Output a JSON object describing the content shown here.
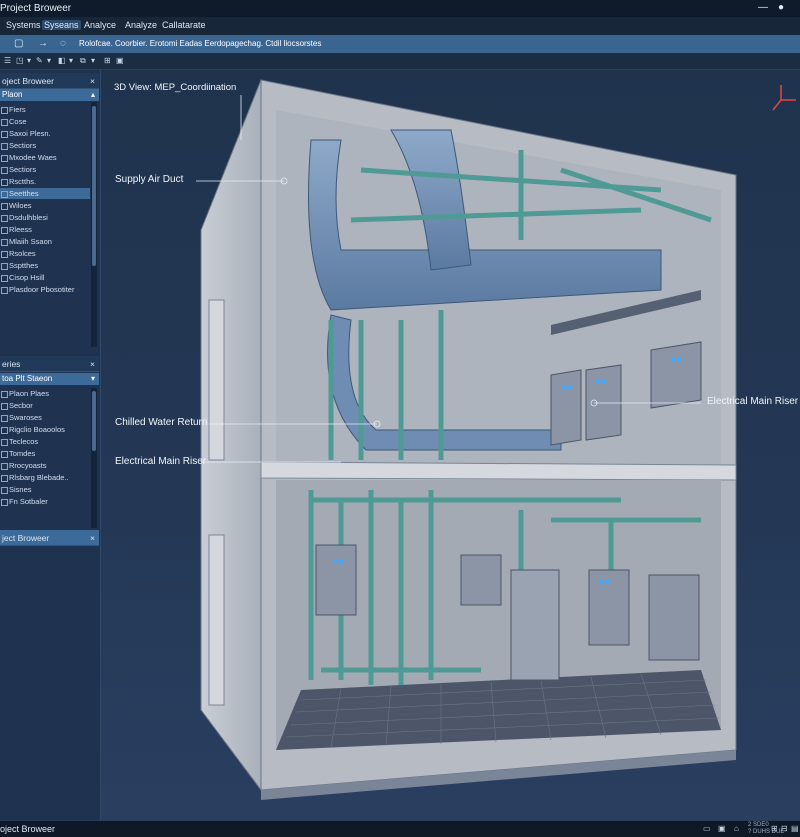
{
  "app": {
    "title": "Project Broweer",
    "window_controls": {
      "minimize": "—",
      "close": "●"
    }
  },
  "menu": {
    "items": [
      "Systems",
      "Syseans",
      "Analyce",
      "Analyze",
      "Callatarate"
    ],
    "active_index": 1
  },
  "ribbon": {
    "icons": [
      "square-icon",
      "arrow-icon",
      "refresh-icon"
    ],
    "text": "Rolofcae. Coorbier. Erotomi Eadas Eerdopagechag. Ctdil liocsorstes"
  },
  "toolbar2": {
    "icons": [
      "☰",
      "◳",
      "▾",
      "✎",
      "▾",
      "◧",
      "▾",
      "⧉",
      "▾",
      "⊞",
      "▣"
    ]
  },
  "sidebar": {
    "panel1": {
      "title": "oject Broweer",
      "close": "×",
      "subheader": "Plaon",
      "items": [
        "Fiers",
        "Cose",
        "Saxoi Plesn.",
        "Sectiors",
        "Mxodee Waes",
        "Sectiors",
        "Rsctths.",
        "Seetthes",
        "Wiloes",
        "Dsdulhblesi",
        "Rleess",
        "Mlaiih Ssaon",
        "Rsolces",
        "Ssptthes",
        "Cisop Hsill",
        "Plasdoor Pbosotiter"
      ],
      "selected_index": 7
    },
    "panel2": {
      "title": "eries",
      "close": "×",
      "subheader": "toa Plt Staeon",
      "items": [
        "Plaon Plaes",
        "Secbor",
        "Swaroses",
        "Rigclio Boaoolos",
        "Teclecos",
        "Tomdes",
        "Rrocyoasts",
        "Rlsbarg Blebade..",
        "Sisnes",
        "Fn Sotbaler"
      ]
    },
    "panel3": {
      "title": "ject Broweer",
      "close": "×"
    }
  },
  "viewport": {
    "title": "3D View: MEP_Coordiination",
    "labels": {
      "supply_air_duct": "Supply Air Duct",
      "chilled_water_return": "Chilled Water Return",
      "electrical_main_riser_left": "Electrical Main Riser",
      "electrical_main_riser_right": "Electrical Main Riser"
    },
    "colors": {
      "duct": "#6f8fb5",
      "pipe": "#4f9a94",
      "walls": "#c3c8cf",
      "floor": "#535c70",
      "indicator": "#3fa9ff"
    }
  },
  "status": {
    "text": "oject Broweer",
    "icons": [
      "▭",
      "▣",
      "⌂",
      "⊞",
      "⊟",
      "▤"
    ],
    "small_lines": [
      "2 SDE0",
      "? DUHS DUE"
    ]
  }
}
